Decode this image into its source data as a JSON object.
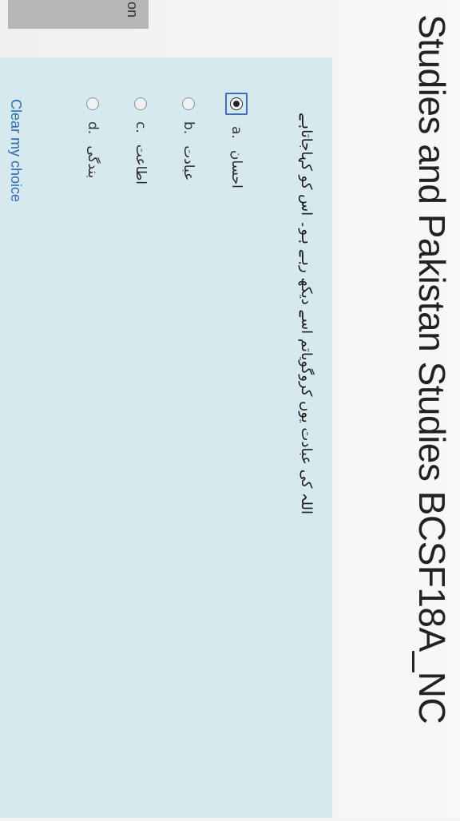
{
  "header": {
    "course_title": "Studies and Pakistan Studies BCSF18A_NC",
    "side_tail": "on"
  },
  "question": {
    "text": "اللہ کی عبادت یوں کروگویاتم اسے دیکھ رہے ہو۔ اس کو کہاجاتاہے",
    "options": [
      {
        "letter": "a.",
        "text": "احسان",
        "selected": true
      },
      {
        "letter": "b.",
        "text": "عبادت",
        "selected": false
      },
      {
        "letter": "c.",
        "text": "اطاعت",
        "selected": false
      },
      {
        "letter": "d.",
        "text": "بندگی",
        "selected": false
      }
    ],
    "clear_label": "Clear my choice"
  },
  "colors": {
    "question_bg": "#d6e9ee",
    "link": "#2f6ab3",
    "focus": "#3a6fb5"
  }
}
